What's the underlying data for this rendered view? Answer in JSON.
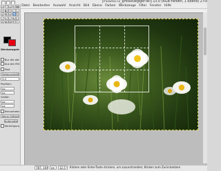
{
  "window": {
    "title": "[P1020172_grosszuegigerTeil] 13.0 (RGB-Farben, 1 Ebene) 2750x1680 – GIMP"
  },
  "menu": [
    "Datei",
    "Bearbeiten",
    "Auswahl",
    "Ansicht",
    "Bild",
    "Ebene",
    "Farben",
    "Werkzeuge",
    "Filter",
    "Fenster",
    "Hilfe"
  ],
  "toolbox": {
    "tools": [
      "rect-select",
      "ellipse-select",
      "free-select",
      "fuzzy-select",
      "color-select",
      "scissors",
      "foreground-select",
      "paths",
      "color-picker",
      "zoom",
      "measure",
      "move",
      "align",
      "crop",
      "rotate",
      "scale",
      "shear",
      "perspective",
      "flip",
      "cage",
      "text",
      "bucket-fill",
      "gradient",
      "pencil",
      "paintbrush"
    ],
    "active_tool_index": 13,
    "colors": {
      "foreground": "#000000",
      "background": "#e60012"
    },
    "options": {
      "header": "Werkzeugeinstellungen",
      "check_current_layer": "Nur die aktive Ebene",
      "check_delete_pixels": "Aus der Mitte aufziehen",
      "check_fixed": "Fest",
      "fixed_mode": "Seitenverhältnis",
      "size_value": "3:2",
      "position_label": "Position:",
      "position_value": "px",
      "size_label": "Größe:",
      "highlight_label": "Hervorheben",
      "guides_select": "Keine Hilfslinien",
      "autoshrink_button": "Automatisch schrumpfen",
      "merged_check": "Vereinigung einbeziehen"
    }
  },
  "status": {
    "units": "px",
    "zoom": "12,5 %",
    "coords": "787, 1047",
    "message": "Klicken oder Enter-Taste drücken, um zuzuschneiden; Klicken zum Zurücksetzen"
  }
}
